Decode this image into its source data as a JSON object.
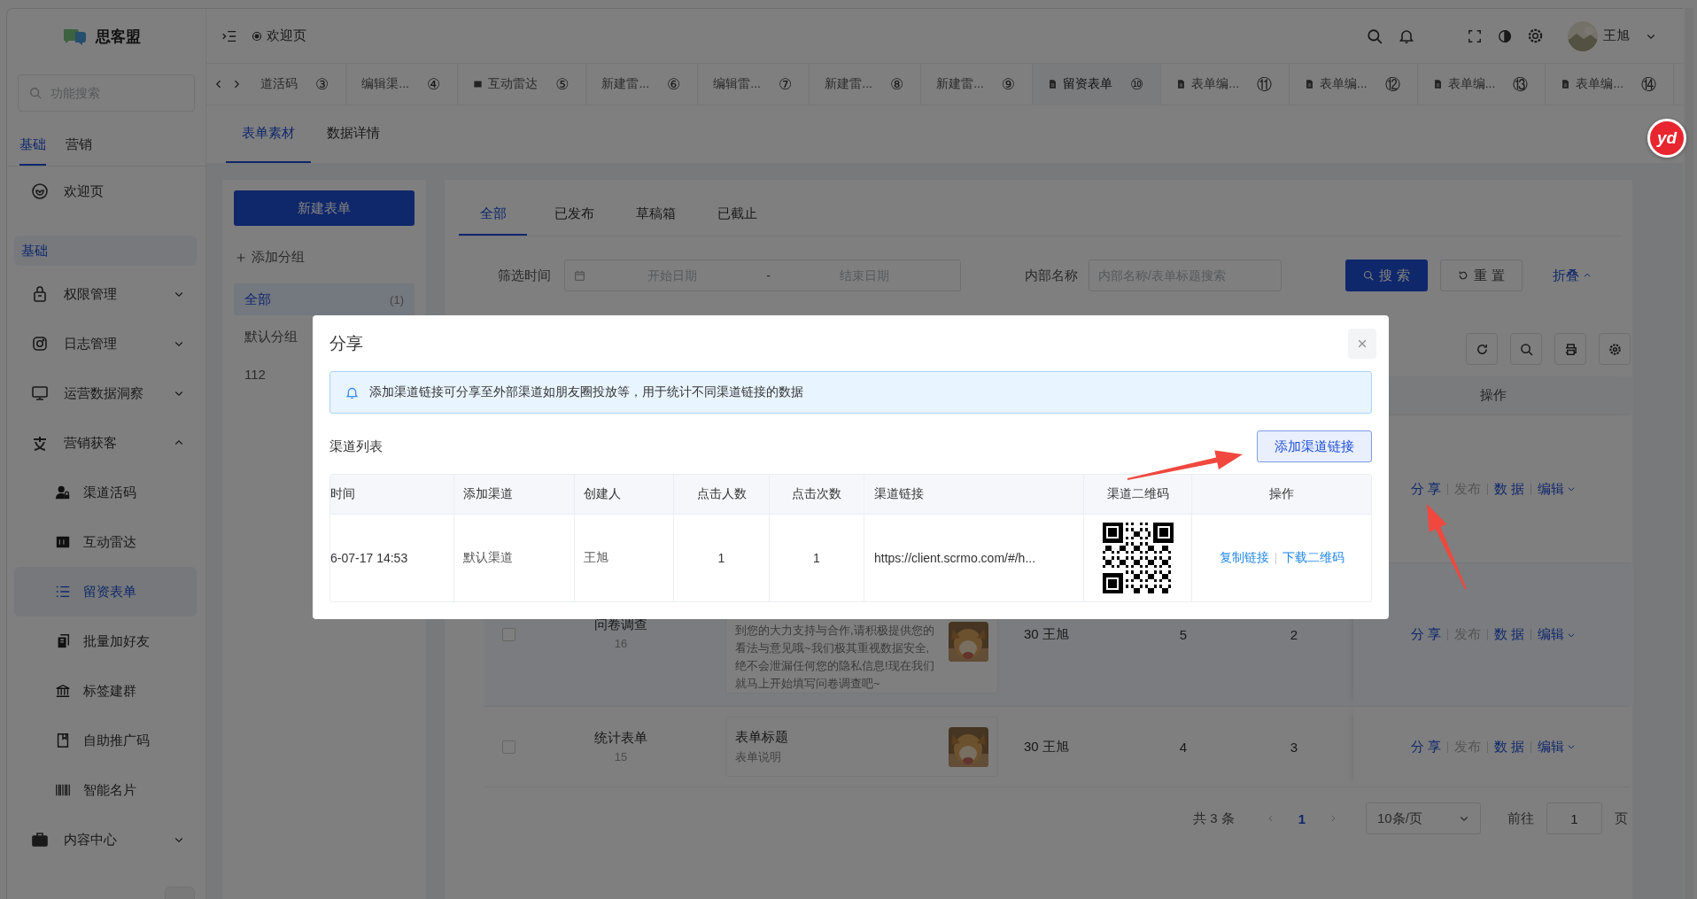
{
  "logo": {
    "text": "思客盟"
  },
  "header": {
    "breadcrumb": "欢迎页",
    "user": "王旭"
  },
  "page_tabs": [
    {
      "label": "道活码",
      "number": "③",
      "kind": "plain",
      "selected": false
    },
    {
      "label": "编辑渠...",
      "number": "④",
      "kind": "plain",
      "selected": false
    },
    {
      "label": "互动雷达",
      "number": "⑤",
      "kind": "square",
      "selected": false
    },
    {
      "label": "新建雷...",
      "number": "⑥",
      "kind": "plain",
      "selected": false
    },
    {
      "label": "编辑雷...",
      "number": "⑦",
      "kind": "plain",
      "selected": false
    },
    {
      "label": "新建雷...",
      "number": "⑧",
      "kind": "plain",
      "selected": false
    },
    {
      "label": "新建雷...",
      "number": "⑨",
      "kind": "plain",
      "selected": false
    },
    {
      "label": "留资表单",
      "number": "⑩",
      "kind": "doc",
      "selected": true
    },
    {
      "label": "表单编...",
      "number": "⑪",
      "kind": "doc",
      "selected": false
    },
    {
      "label": "表单编...",
      "number": "⑫",
      "kind": "doc",
      "selected": false
    },
    {
      "label": "表单编...",
      "number": "⑬",
      "kind": "doc",
      "selected": false
    },
    {
      "label": "表单编...",
      "number": "⑭",
      "kind": "doc",
      "selected": false
    }
  ],
  "content_tabs": [
    {
      "label": "表单素材",
      "selected": true
    },
    {
      "label": "数据详情",
      "selected": false
    }
  ],
  "sidebar": {
    "search": {
      "placeholder": "功能搜索"
    },
    "tabs": [
      {
        "label": "基础",
        "selected": true
      },
      {
        "label": "营销",
        "selected": false
      }
    ],
    "menu": [
      {
        "kind": "link",
        "label": "欢迎页"
      },
      {
        "kind": "section",
        "label": "基础"
      },
      {
        "kind": "group",
        "label": "权限管理",
        "expanded": false
      },
      {
        "kind": "group",
        "label": "日志管理",
        "expanded": false
      },
      {
        "kind": "group",
        "label": "运营数据洞察",
        "expanded": false
      },
      {
        "kind": "group",
        "label": "营销获客",
        "expanded": true,
        "children": [
          {
            "label": "渠道活码",
            "selected": false
          },
          {
            "label": "互动雷达",
            "selected": false
          },
          {
            "label": "留资表单",
            "selected": true
          },
          {
            "label": "批量加好友",
            "selected": false
          },
          {
            "label": "标签建群",
            "selected": false
          },
          {
            "label": "自助推广码",
            "selected": false
          },
          {
            "label": "智能名片",
            "selected": false
          }
        ]
      },
      {
        "kind": "group",
        "label": "内容中心",
        "expanded": false
      }
    ]
  },
  "groups": {
    "new_button": "新建表单",
    "add_group": "添加分组",
    "items": [
      {
        "label": "全部",
        "count": "(1)",
        "selected": true
      },
      {
        "label": "默认分组",
        "selected": false
      },
      {
        "label": "112",
        "selected": false
      }
    ]
  },
  "filter_tabs": [
    {
      "label": "全部",
      "selected": true
    },
    {
      "label": "已发布",
      "selected": false
    },
    {
      "label": "草稿箱",
      "selected": false
    },
    {
      "label": "已截止",
      "selected": false
    }
  ],
  "filters": {
    "time_label": "筛选时间",
    "start": {
      "placeholder": "开始日期"
    },
    "separator": "-",
    "end": {
      "placeholder": "结束日期"
    },
    "name_label": "内部名称",
    "name": {
      "placeholder": "内部名称/表单标题搜索"
    },
    "search_button": "搜 索",
    "reset_button": "重 置",
    "collapse_link": "折叠"
  },
  "table": {
    "columns": [
      {
        "label": "操作"
      }
    ],
    "rows": [
      {
        "actions": [
          {
            "label": "分 享",
            "kind": "link",
            "disabled": false
          },
          {
            "label": "发布",
            "kind": "link",
            "disabled": true
          },
          {
            "label": "数 据",
            "kind": "link",
            "disabled": false
          },
          {
            "label": "编辑",
            "kind": "dropdown",
            "disabled": false
          }
        ]
      },
      {
        "checked": false,
        "title": "问卷调查",
        "number": "16",
        "card_text": "到您的大力支持与合作,请积极提供您的看法与意见哦~我们极其重视数据安全,绝不会泄漏任何您的隐私信息!现在我们就马上开始填写问卷调查吧~",
        "creator": "30 王旭",
        "column_5": "5",
        "column_6": "2",
        "actions": [
          {
            "label": "分 享",
            "kind": "link",
            "disabled": false
          },
          {
            "label": "发布",
            "kind": "link",
            "disabled": true
          },
          {
            "label": "数 据",
            "kind": "link",
            "disabled": false
          },
          {
            "label": "编辑",
            "kind": "dropdown",
            "disabled": false
          }
        ]
      },
      {
        "checked": false,
        "title": "统计表单",
        "number": "15",
        "card_title": "表单标题",
        "card_text": "表单说明",
        "creator": "30 王旭",
        "column_5": "4",
        "column_6": "3",
        "actions": [
          {
            "label": "分 享",
            "kind": "link",
            "disabled": false
          },
          {
            "label": "发布",
            "kind": "link",
            "disabled": true
          },
          {
            "label": "数 据",
            "kind": "link",
            "disabled": false
          },
          {
            "label": "编辑",
            "kind": "dropdown",
            "disabled": false
          }
        ]
      }
    ]
  },
  "pagination": {
    "total": "共 3 条",
    "pages": [
      {
        "label": "1",
        "selected": true
      }
    ],
    "page_size": "10条/页",
    "goto_label": "前往",
    "goto_value": "1",
    "page_suffix": "页"
  },
  "modal": {
    "title": "分享",
    "alert": "添加渠道链接可分享至外部渠道如朋友圈投放等，用于统计不同渠道链接的数据",
    "list_label": "渠道列表",
    "add_button": "添加渠道链接",
    "columns": [
      "时间",
      "添加渠道",
      "创建人",
      "点击人数",
      "点击次数",
      "渠道链接",
      "渠道二维码",
      "操作"
    ],
    "rows": [
      {
        "cells": [
          "6-07-17 14:53",
          "默认渠道",
          "王旭",
          "1",
          "1",
          "https://client.scrmo.com/#/h..."
        ],
        "actions": [
          "复制链接",
          "下载二维码"
        ]
      }
    ]
  },
  "extension_badge": {
    "text": "yd"
  }
}
